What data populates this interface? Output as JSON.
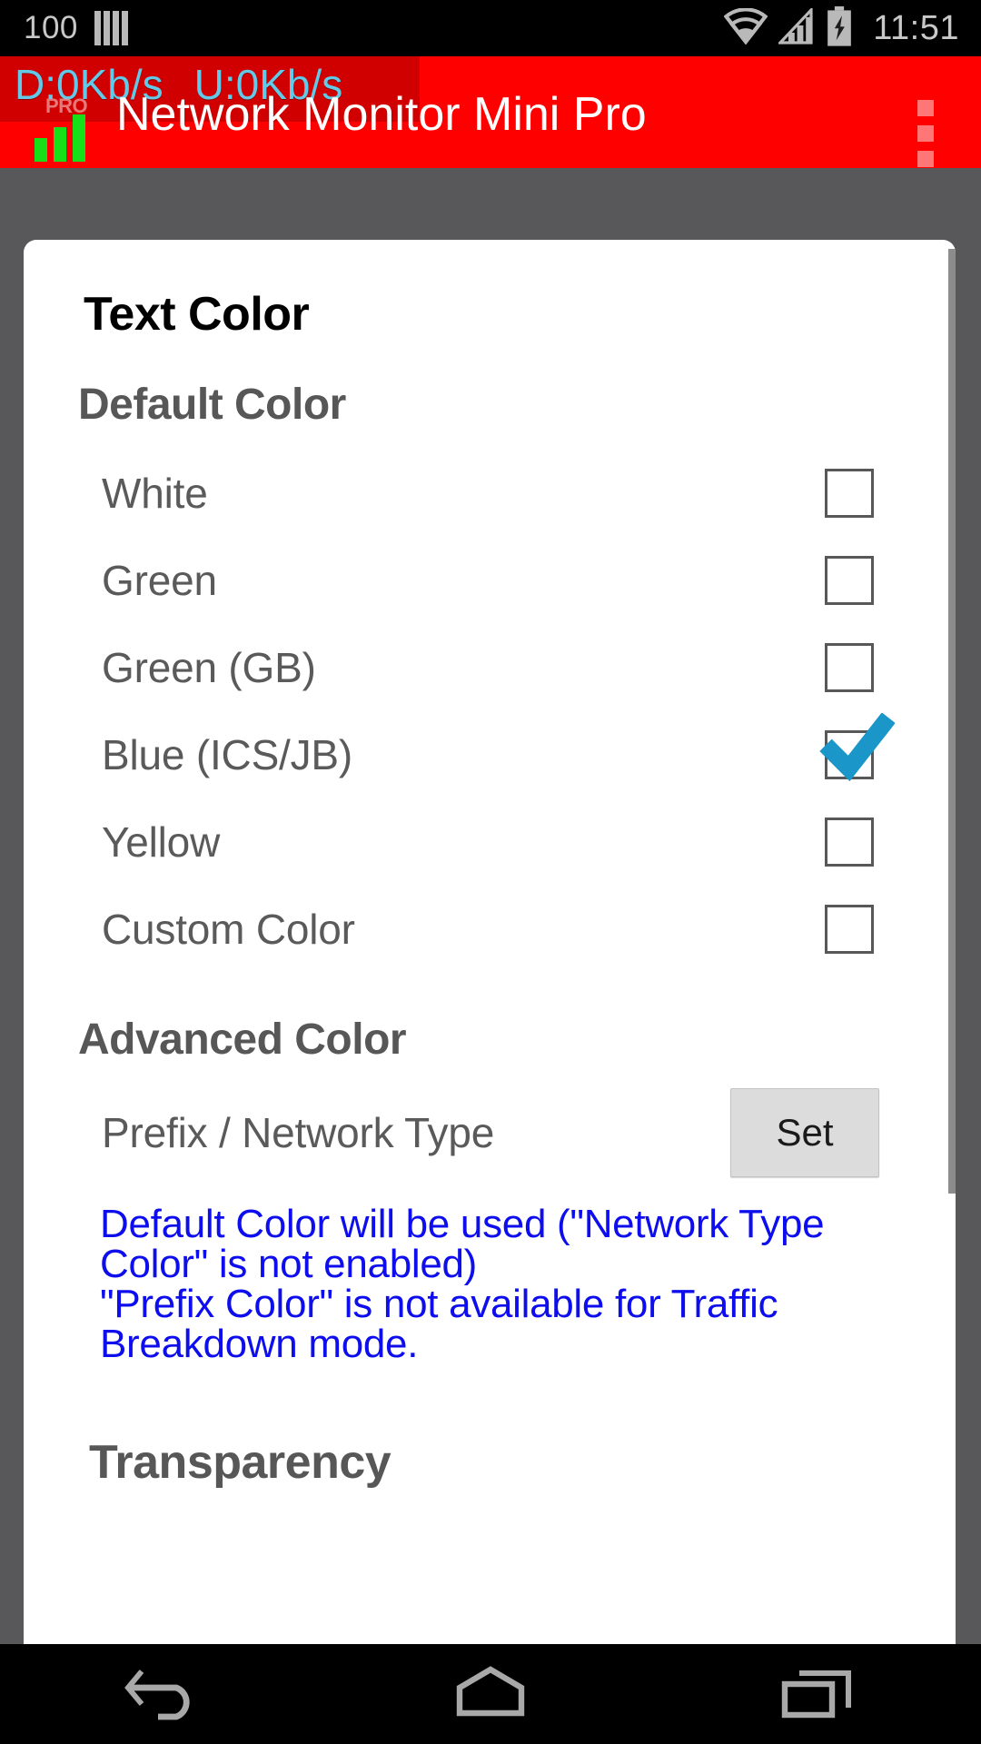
{
  "statusbar": {
    "battery_percent": "100",
    "signal_icon": "signal-bars-icon",
    "wifi_icon": "wifi-icon",
    "cell_icon": "cellular-signal-icon",
    "battery_icon": "battery-charging-icon",
    "time": "11:51"
  },
  "actionbar": {
    "speed_download": "D:0Kb/s",
    "speed_upload": "U:0Kb/s",
    "app_icon_badge": "PRO",
    "title": "Network Monitor Mini Pro",
    "overflow_icon": "overflow-menu-icon",
    "bg_color": "#ff0000",
    "speed_text_color": "#62c9e8"
  },
  "card": {
    "page_title": "Text Color",
    "default_color": {
      "heading": "Default Color",
      "options": [
        {
          "label": "White",
          "checked": false
        },
        {
          "label": "Green",
          "checked": false
        },
        {
          "label": "Green (GB)",
          "checked": false
        },
        {
          "label": "Blue (ICS/JB)",
          "checked": true
        },
        {
          "label": "Yellow",
          "checked": false
        },
        {
          "label": "Custom Color",
          "checked": false
        }
      ]
    },
    "advanced_color": {
      "heading": "Advanced Color",
      "row_label": "Prefix / Network Type",
      "set_button": "Set",
      "info_line_1": "Default Color will be used (\"Network Type Color\" is not enabled)",
      "info_line_2": "\"Prefix Color\" is not available for Traffic Breakdown mode.",
      "info_color": "#0d0dee"
    },
    "transparency": {
      "heading": "Transparency"
    }
  },
  "navbar": {
    "back": "back-icon",
    "home": "home-icon",
    "recents": "recents-icon"
  }
}
